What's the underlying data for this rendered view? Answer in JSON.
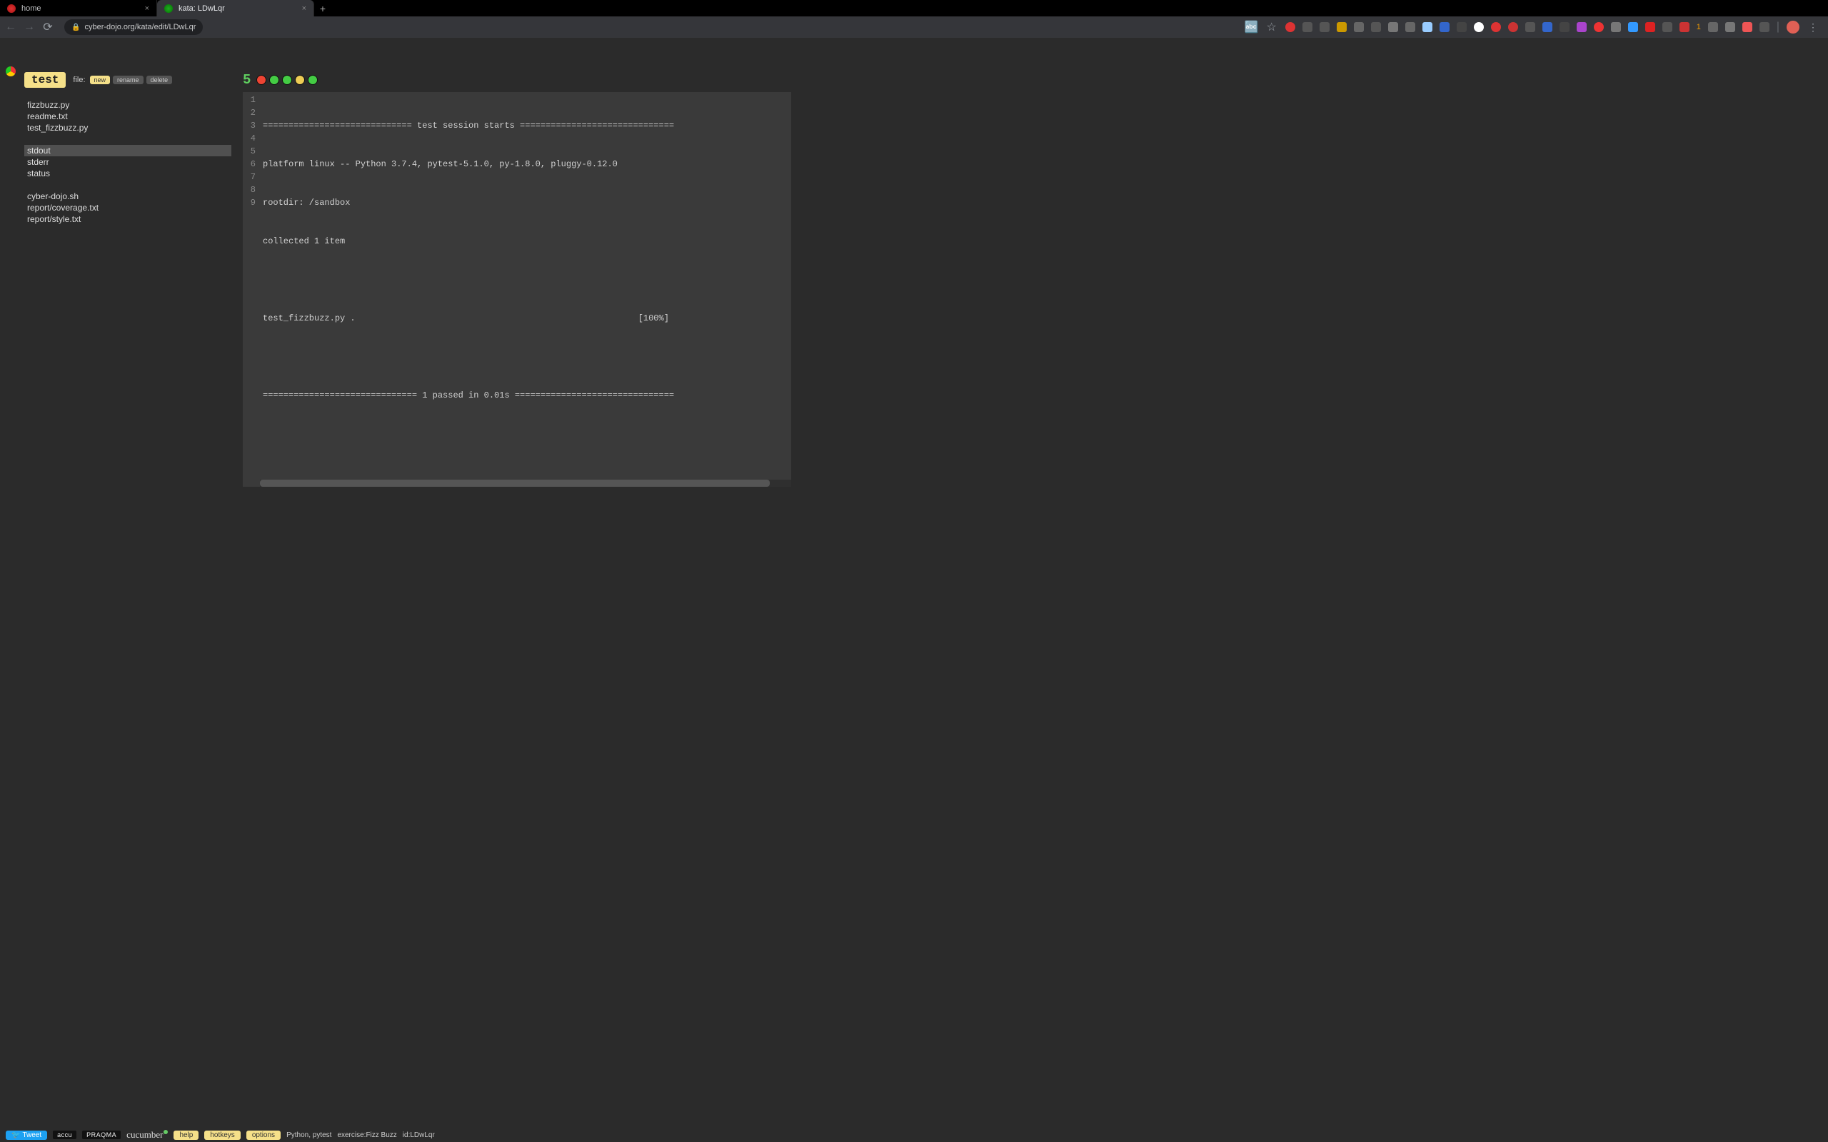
{
  "browser": {
    "tabs": [
      {
        "title": "home",
        "favicon": "fav-red"
      },
      {
        "title": "kata: LDwLqr",
        "favicon": "fav-green"
      }
    ],
    "url": "cyber-dojo.org/kata/edit/LDwLqr"
  },
  "toolbar": {
    "test_label": "test",
    "file_label": "file:",
    "pill_new": "new",
    "pill_rename": "rename",
    "pill_delete": "delete"
  },
  "files": {
    "group1": [
      "fizzbuzz.py",
      "readme.txt",
      "test_fizzbuzz.py"
    ],
    "group2": [
      "stdout",
      "stderr",
      "status"
    ],
    "group3": [
      "cyber-dojo.sh",
      "report/coverage.txt",
      "report/style.txt"
    ],
    "selected": "stdout"
  },
  "run": {
    "number": "5",
    "lights": [
      "red",
      "green",
      "green",
      "amber",
      "green"
    ]
  },
  "editor": {
    "lines": [
      "============================= test session starts ==============================",
      "platform linux -- Python 3.7.4, pytest-5.1.0, py-1.8.0, pluggy-0.12.0",
      "rootdir: /sandbox",
      "collected 1 item",
      "",
      "test_fizzbuzz.py .                                                       [100%]",
      "",
      "============================== 1 passed in 0.01s ===============================",
      ""
    ]
  },
  "footer": {
    "tweet": "Tweet",
    "sponsor_accu": "accu",
    "sponsor_praqma": "PRAQMA",
    "sponsor_cucumber": "cucumber",
    "help": "help",
    "hotkeys": "hotkeys",
    "options": "options",
    "lang": "Python, pytest",
    "exercise": "exercise:Fizz Buzz",
    "id": "id:LDwLqr"
  }
}
